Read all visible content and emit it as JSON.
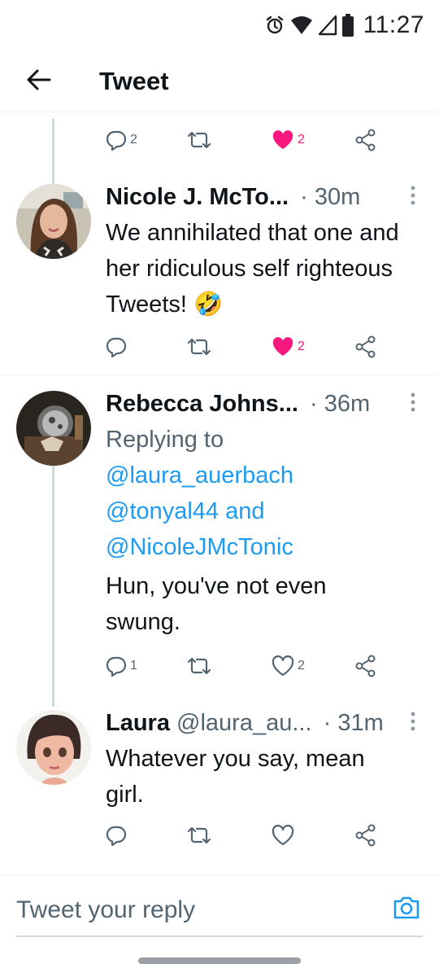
{
  "status_bar": {
    "time": "11:27",
    "icons": [
      "alarm-icon",
      "wifi-icon",
      "signal-icon",
      "battery-icon"
    ]
  },
  "header": {
    "title": "Tweet",
    "back_icon": "arrow-left-icon"
  },
  "colors": {
    "accent": "#1d9bf0",
    "like": "#f91880",
    "muted": "#536471",
    "text": "#0f1419"
  },
  "top_actions": {
    "reply_count": "2",
    "retweet_count": "",
    "like_count": "2",
    "liked": true
  },
  "tweets": [
    {
      "author": "Nicole J. McTo...",
      "handle": "",
      "time": "30m",
      "text": "We annihilated that one and her ridiculous self righteous Tweets!",
      "emoji": "🤣",
      "reply_count": "",
      "retweet_count": "",
      "like_count": "2",
      "liked": true
    },
    {
      "author": "Rebecca Johns...",
      "handle": "",
      "time": "36m",
      "replying_label": "Replying to",
      "mentions": [
        "@laura_auerbach",
        "@tonyal44",
        "@NicoleJMcTonic"
      ],
      "mention_joiner": "and",
      "text": "Hun, you've not even swung.",
      "reply_count": "1",
      "retweet_count": "",
      "like_count": "2",
      "liked": false
    },
    {
      "author": "Laura",
      "handle": "@laura_au...",
      "time": "31m",
      "text": "Whatever you say, mean girl.",
      "reply_count": "",
      "retweet_count": "",
      "like_count": "",
      "liked": false
    }
  ],
  "reply_bar": {
    "placeholder": "Tweet your reply",
    "camera_icon": "camera-icon"
  }
}
